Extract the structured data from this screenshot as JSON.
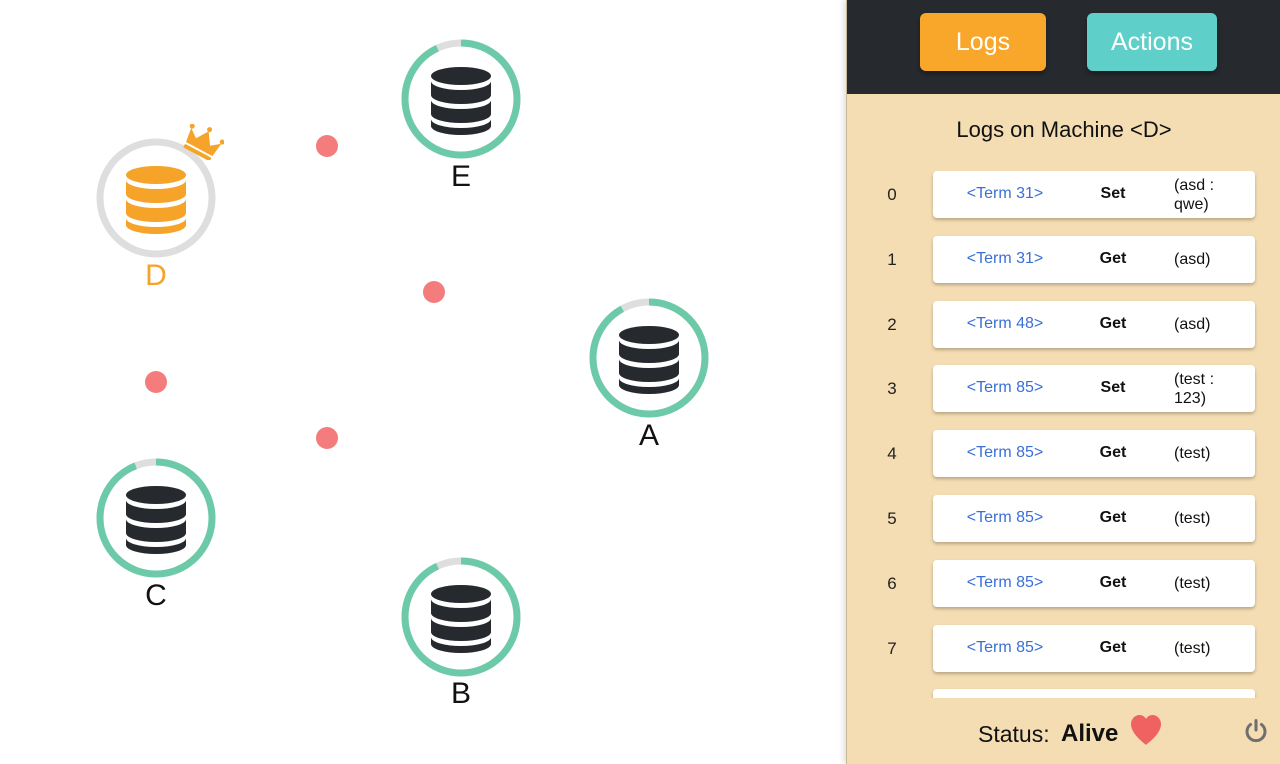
{
  "colors": {
    "leader": "#f5a429",
    "follower": "#262a2f",
    "ring_progress": "#6ccaa9",
    "ring_track": "#dedede",
    "message": "#f47c7c",
    "panel_bg": "#f4ddb2",
    "panel_header_bg": "#262a2f",
    "logs_button": "#f9a72b",
    "actions_button": "#5fd0c9",
    "term_text": "#3a6fd6",
    "heart": "#f06262"
  },
  "nodes": [
    {
      "id": "E",
      "label": "E",
      "role": "follower",
      "timeout_progress": 0.93
    },
    {
      "id": "D",
      "label": "D",
      "role": "leader",
      "timeout_progress": 0.0,
      "icon": "crown-icon"
    },
    {
      "id": "A",
      "label": "A",
      "role": "follower",
      "timeout_progress": 0.92
    },
    {
      "id": "C",
      "label": "C",
      "role": "follower",
      "timeout_progress": 0.94
    },
    {
      "id": "B",
      "label": "B",
      "role": "follower",
      "timeout_progress": 0.93
    }
  ],
  "messages_in_flight": 4,
  "panel": {
    "tabs": {
      "logs": "Logs",
      "actions": "Actions"
    },
    "logs_title": "Logs on Machine <D>",
    "log_entries": [
      {
        "index": "0",
        "term": "<Term 31>",
        "op": "Set",
        "args_line1": "(asd :",
        "args_line2": "qwe)"
      },
      {
        "index": "1",
        "term": "<Term 31>",
        "op": "Get",
        "args_line1": "(asd)",
        "args_line2": ""
      },
      {
        "index": "2",
        "term": "<Term 48>",
        "op": "Get",
        "args_line1": "(asd)",
        "args_line2": ""
      },
      {
        "index": "3",
        "term": "<Term 85>",
        "op": "Set",
        "args_line1": "(test :",
        "args_line2": "123)"
      },
      {
        "index": "4",
        "term": "<Term 85>",
        "op": "Get",
        "args_line1": "(test)",
        "args_line2": ""
      },
      {
        "index": "5",
        "term": "<Term 85>",
        "op": "Get",
        "args_line1": "(test)",
        "args_line2": ""
      },
      {
        "index": "6",
        "term": "<Term 85>",
        "op": "Get",
        "args_line1": "(test)",
        "args_line2": ""
      },
      {
        "index": "7",
        "term": "<Term 85>",
        "op": "Get",
        "args_line1": "(test)",
        "args_line2": ""
      }
    ],
    "status_label": "Status:",
    "status_value": "Alive",
    "status_icon": "heart-icon",
    "power_icon": "power-icon"
  }
}
